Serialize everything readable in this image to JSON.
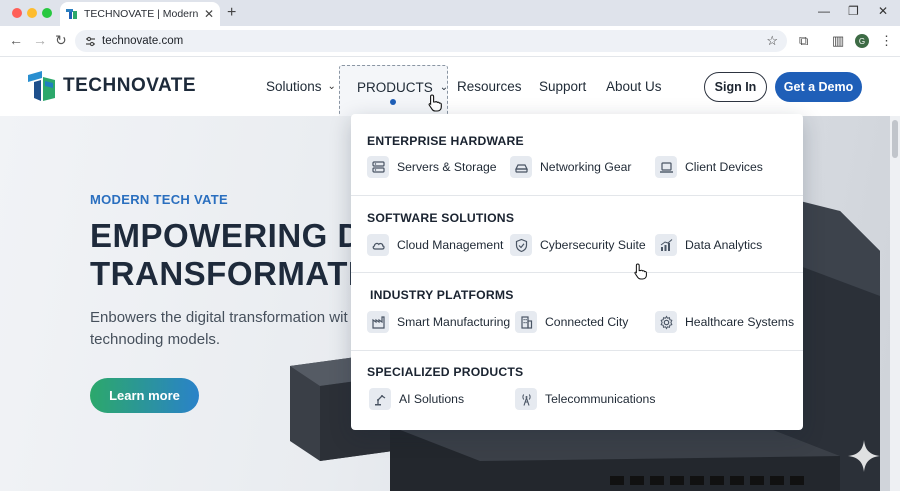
{
  "browser": {
    "tab_title": "TECHNOVATE | Modern Brows",
    "url": "technovate.com",
    "profile_initial": "G",
    "controls": {
      "close_color": "#ff5f57",
      "minimize_color": "#febc2e",
      "maximize_color": "#28c840"
    }
  },
  "site": {
    "brand": "TECHNOVATE",
    "nav": {
      "solutions": "Solutions",
      "products": "PRODUCTS",
      "resources": "Resources",
      "support": "Support",
      "about": "About Us"
    },
    "signin": "Sign In",
    "demo": "Get a Demo",
    "accent_color": "#1f5fb8"
  },
  "hero": {
    "eyebrow": "MODERN TECH VATE",
    "title_line1": "EMPOWERING DIG",
    "title_line2": "TRANSFORMATIO",
    "description": "Enbowers the digital transformation wit technoding models.",
    "cta": "Learn more"
  },
  "mega_menu": {
    "sections": [
      {
        "title": "ENTERPRISE HARDWARE",
        "items": [
          {
            "label": "Servers & Storage",
            "icon": "server-icon"
          },
          {
            "label": "Networking Gear",
            "icon": "router-icon"
          },
          {
            "label": "Client Devices",
            "icon": "laptop-icon"
          }
        ]
      },
      {
        "title": "SOFTWARE SOLUTIONS",
        "items": [
          {
            "label": "Cloud Management",
            "icon": "cloud-icon"
          },
          {
            "label": "Cybersecurity Suite",
            "icon": "shield-icon"
          },
          {
            "label": "Data Analytics",
            "icon": "chart-icon"
          }
        ]
      },
      {
        "title": "INDUSTRY PLATFORMS",
        "items": [
          {
            "label": "Smart Manufacturing",
            "icon": "factory-icon"
          },
          {
            "label": "Connected City",
            "icon": "building-icon"
          },
          {
            "label": "Healthcare Systems",
            "icon": "gear-icon"
          }
        ]
      },
      {
        "title": "SPECIALIZED PRODUCTS",
        "items": [
          {
            "label": "AI Solutions",
            "icon": "robot-arm-icon"
          },
          {
            "label": "Telecommunications",
            "icon": "antenna-icon"
          }
        ]
      }
    ]
  }
}
